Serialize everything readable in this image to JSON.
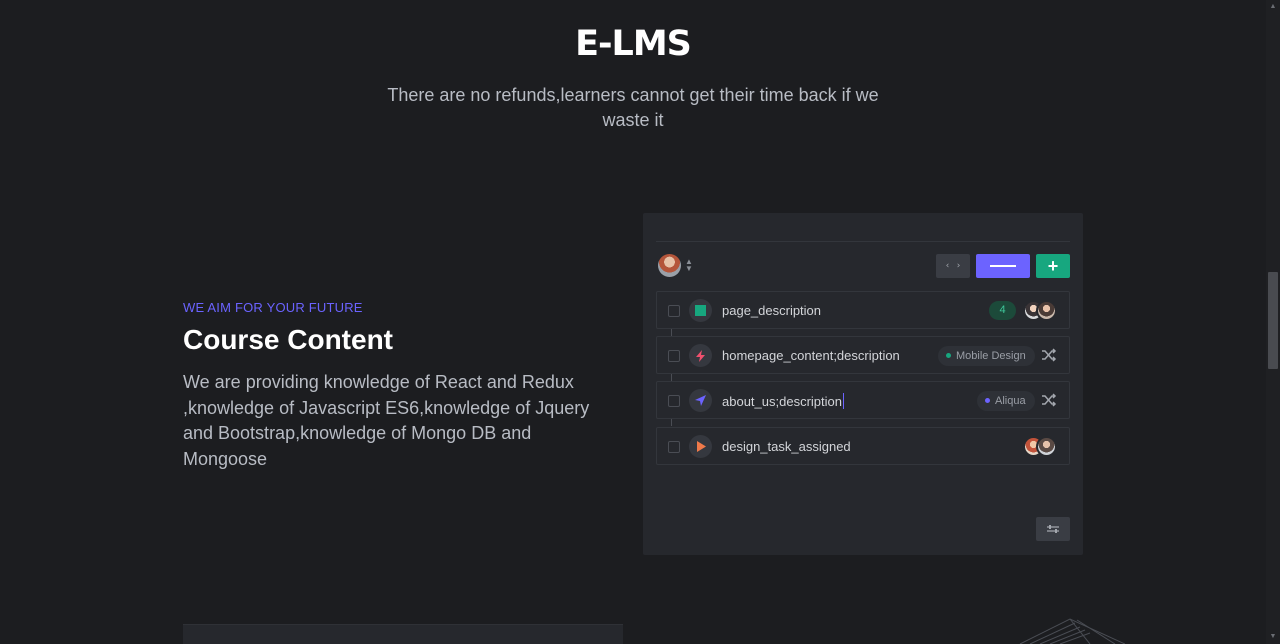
{
  "hero": {
    "title": "E-LMS",
    "subtitle": "There are no refunds,learners cannot get their time back if we waste it"
  },
  "section": {
    "kicker": "WE AIM FOR YOUR FUTURE",
    "title": "Course Content",
    "body": "We are providing knowledge of React and Redux ,knowledge of Javascript ES6,knowledge of Jquery and Bootstrap,knowledge of Mongo DB and Mongoose"
  },
  "panel": {
    "toolbar": {
      "user_avatar_icon": "user-avatar",
      "sort_icon": "sort-icon",
      "code_icon": "code-icon",
      "add_icon": "plus-icon"
    },
    "rows": [
      {
        "label": "page_description",
        "icon": "zendesk-icon",
        "icon_color": "#17a77f",
        "count": "4"
      },
      {
        "label": "homepage_content;description",
        "icon": "bolt-icon",
        "icon_color": "#f0506e",
        "tag": "Mobile Design",
        "tag_color": "#17a77f"
      },
      {
        "label": "about_us;description",
        "icon": "send-icon",
        "icon_color": "#6c63ff",
        "tag": "Aliqua",
        "tag_color": "#6c63ff"
      },
      {
        "label": "design_task_assigned",
        "icon": "play-icon",
        "icon_color": "#f07a4a"
      }
    ],
    "settings_icon": "sliders-icon"
  },
  "colors": {
    "background": "#1c1d20",
    "panel": "#26282d",
    "accent": "#6c63ff",
    "green": "#17a77f"
  }
}
